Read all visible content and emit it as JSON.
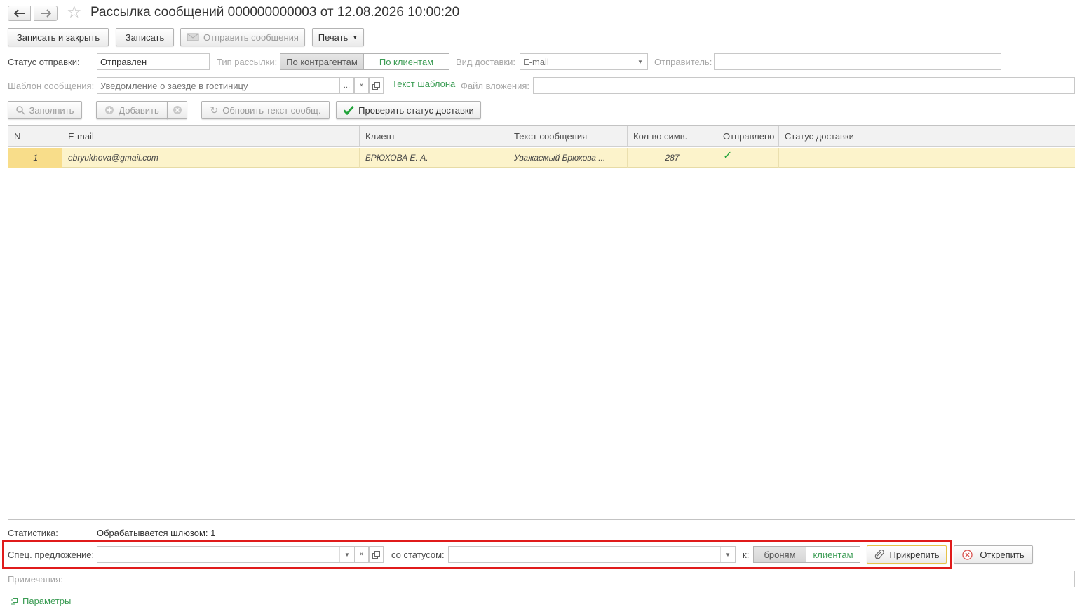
{
  "window": {
    "title": "Рассылка сообщений 000000000003 от 12.08.2026 10:00:20",
    "back_icon": "arrow-left-icon",
    "forward_icon": "arrow-right-icon",
    "favorite_icon": "star-icon"
  },
  "toolbar": {
    "write_close": "Записать и закрыть",
    "write": "Записать",
    "send": "Отправить сообщения",
    "print": "Печать"
  },
  "form": {
    "status_label": "Статус отправки:",
    "status_value": "Отправлен",
    "type_label": "Тип рассылки:",
    "type_options": [
      "По контрагентам",
      "По клиентам"
    ],
    "type_selected": "По контрагентам",
    "delivery_label": "Вид доставки:",
    "delivery_value": "E-mail",
    "sender_label": "Отправитель:",
    "sender_value": "",
    "template_label": "Шаблон сообщения:",
    "template_value": "Уведомление о заезде в гостиницу",
    "template_more": "...",
    "template_clear": "×",
    "template_text_link": "Текст шаблона",
    "attachment_label": "Файл вложения:",
    "attachment_value": ""
  },
  "actions": {
    "fill": "Заполнить",
    "add": "Добавить",
    "refresh_text": "Обновить текст сообщ.",
    "check_status": "Проверить статус доставки"
  },
  "table": {
    "columns": [
      "N",
      "E-mail",
      "Клиент",
      "Текст сообщения",
      "Кол-во симв.",
      "Отправлено",
      "Статус доставки"
    ],
    "rows": [
      {
        "n": "1",
        "email": "ebryukhova@gmail.com",
        "client": "БРЮХОВА Е. А.",
        "text": "Уважаемый  Брюхова ...",
        "chars": "287",
        "sent": "✓",
        "delivery_status": ""
      }
    ]
  },
  "stats": {
    "label": "Статистика:",
    "value": "Обрабатывается шлюзом: 1"
  },
  "offer": {
    "label": "Спец. предложение:",
    "value": "",
    "clear": "×",
    "status_label": "со статусом:",
    "status_value": "",
    "to_label": "к:",
    "to_options": [
      "броням",
      "клиентам"
    ],
    "to_selected": "броням",
    "attach": "Прикрепить",
    "detach": "Открепить"
  },
  "notes": {
    "label": "Примечания:",
    "value": ""
  },
  "params_link": "Параметры",
  "colors": {
    "accent_green": "#3b9c54",
    "row_highlight": "#fcf3cb",
    "highlight_box": "#e01b1b"
  }
}
